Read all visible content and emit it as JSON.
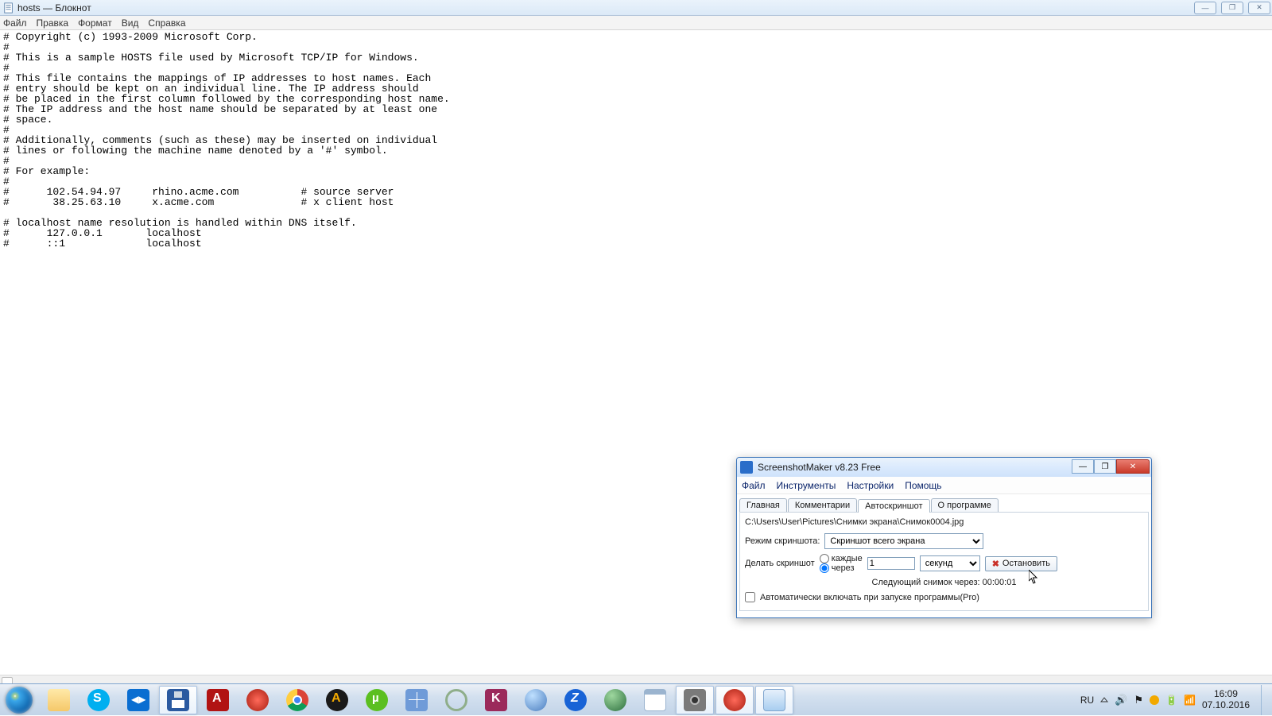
{
  "notepad": {
    "title": "hosts — Блокнот",
    "menu": {
      "file": "Файл",
      "edit": "Правка",
      "format": "Формат",
      "view": "Вид",
      "help": "Справка"
    },
    "content": "# Copyright (c) 1993-2009 Microsoft Corp.\n#\n# This is a sample HOSTS file used by Microsoft TCP/IP for Windows.\n#\n# This file contains the mappings of IP addresses to host names. Each\n# entry should be kept on an individual line. The IP address should\n# be placed in the first column followed by the corresponding host name.\n# The IP address and the host name should be separated by at least one\n# space.\n#\n# Additionally, comments (such as these) may be inserted on individual\n# lines or following the machine name denoted by a '#' symbol.\n#\n# For example:\n#\n#      102.54.94.97     rhino.acme.com          # source server\n#       38.25.63.10     x.acme.com              # x client host\n\n# localhost name resolution is handled within DNS itself.\n#      127.0.0.1       localhost\n#      ::1             localhost"
  },
  "dialog": {
    "title": "ScreenshotMaker v8.23 Free",
    "menu": {
      "file": "Файл",
      "tools": "Инструменты",
      "settings": "Настройки",
      "help": "Помощь"
    },
    "tabs": {
      "main": "Главная",
      "comments": "Комментарии",
      "auto": "Автоскриншот",
      "about": "О программе"
    },
    "path": "C:\\Users\\User\\Pictures\\Снимки экрана\\Снимок0004.jpg",
    "mode_label": "Режим скриншота:",
    "mode_value": "Скриншот всего экрана",
    "make_label": "Делать скриншот",
    "radio_every": "каждые",
    "radio_after": "через",
    "interval_value": "1",
    "unit_value": "секунд",
    "stop_label": "Остановить",
    "next_label": "Следующий снимок через: 00:00:01",
    "autostart_label": "Автоматически включать при запуске программы(Pro)"
  },
  "taskbar": {
    "lang": "RU",
    "time": "16:09",
    "date": "07.10.2016",
    "icons": {
      "explorer": "#f5c869",
      "skype": "#00aff0",
      "teamviewer": "#0a6ed1",
      "save": "#2b5aa0",
      "acrobat": "#b11313",
      "opera1": "#d83c2e",
      "chrome": "#f2c14e",
      "aimp": "#f2a900",
      "utorrent": "#5bbf21",
      "calc": "#6f9bd8",
      "circle": "#8fae8a",
      "k": "#9b2a5b",
      "globe1": "#4a7dbf",
      "z": "#1863d6",
      "globe2": "#2c6f3e",
      "window": "#9bb4cf",
      "ssmaker": "#7a7a7a",
      "opera2": "#d83c2e",
      "bluewin": "#a8cef0"
    }
  }
}
